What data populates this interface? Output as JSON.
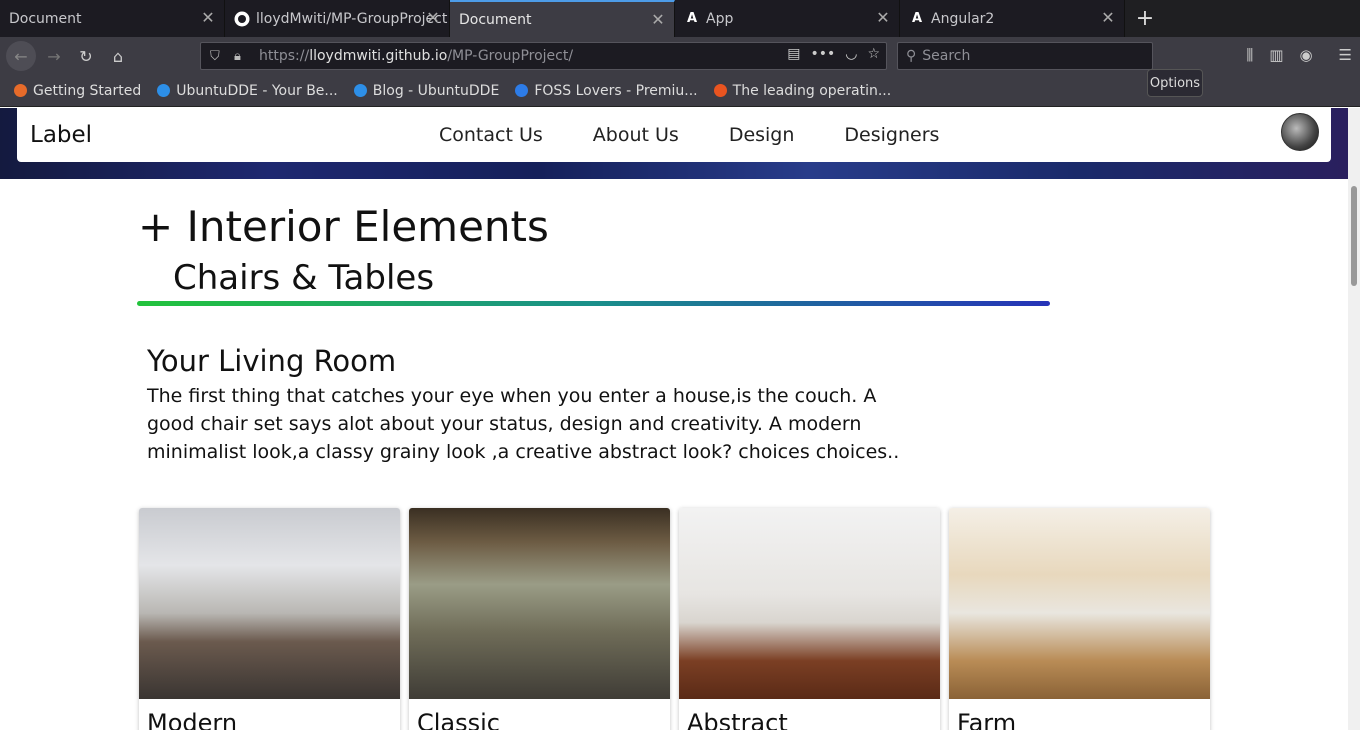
{
  "browser": {
    "tabs": [
      {
        "title": "Document",
        "active": false
      },
      {
        "title": "lloydMwiti/MP-GroupProject",
        "active": false
      },
      {
        "title": "Document",
        "active": true
      },
      {
        "title": "App",
        "active": false
      },
      {
        "title": "Angular2",
        "active": false
      }
    ],
    "url_prefix": "https://",
    "url_host": "lloydmwiti.github.io",
    "url_path": "/MP-GroupProject/",
    "search_placeholder": "Search",
    "tooltip": "Options",
    "bookmarks": [
      {
        "label": "Getting Started",
        "color": "#e76b2a"
      },
      {
        "label": "UbuntuDDE - Your Be...",
        "color": "#2d8fe8"
      },
      {
        "label": "Blog - UbuntuDDE",
        "color": "#2d8fe8"
      },
      {
        "label": "FOSS Lovers - Premiu...",
        "color": "#2d7ce8"
      },
      {
        "label": "The leading operatin...",
        "color": "#e95420"
      }
    ]
  },
  "site": {
    "brand": "Label",
    "menu": [
      "Contact Us",
      "About Us",
      "Design",
      "Designers"
    ]
  },
  "section": {
    "title": "+ Interior Elements",
    "subtitle": "Chairs & Tables",
    "heading": "Your Living Room",
    "paragraph": "The first thing that catches your eye when you enter a house,is the couch. A good chair set says alot about your status, design and creativity. A modern minimalist look,a classy grainy look ,a creative abstract look? choices choices.."
  },
  "cards": [
    {
      "name": "Modern"
    },
    {
      "name": "Classic"
    },
    {
      "name": "Abstract"
    },
    {
      "name": "Farm"
    }
  ]
}
